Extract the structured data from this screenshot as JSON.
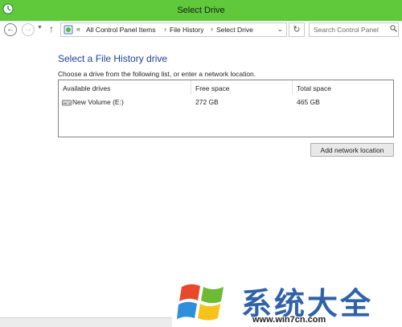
{
  "window": {
    "title": "Select Drive",
    "titlebar_color": "#5fc93b"
  },
  "navigation": {
    "back_icon": "arrow-left",
    "forward_icon": "arrow-right",
    "history_icon": "chevron-down",
    "up_icon": "arrow-up",
    "breadcrumb_overflow": "«",
    "breadcrumbs": [
      "All Control Panel Items",
      "File History",
      "Select Drive"
    ],
    "separator": "›",
    "dropdown_icon": "chevron-down",
    "refresh_icon": "refresh"
  },
  "search": {
    "placeholder": "Search Control Panel"
  },
  "content": {
    "heading": "Select a File History drive",
    "instruction": "Choose a drive from the following list, or enter a network location."
  },
  "drive_table": {
    "columns": [
      "Available drives",
      "Free space",
      "Total space"
    ],
    "rows": [
      {
        "name": "New Volume (E:)",
        "free": "272 GB",
        "total": "465 GB",
        "icon": "hard-drive"
      }
    ]
  },
  "actions": {
    "add_network_label": "Add network location"
  },
  "watermark": {
    "text": "系统大全",
    "url": "www.win7cn.com",
    "color": "#2f62a9"
  },
  "colors": {
    "heading": "#1e3f9b"
  }
}
